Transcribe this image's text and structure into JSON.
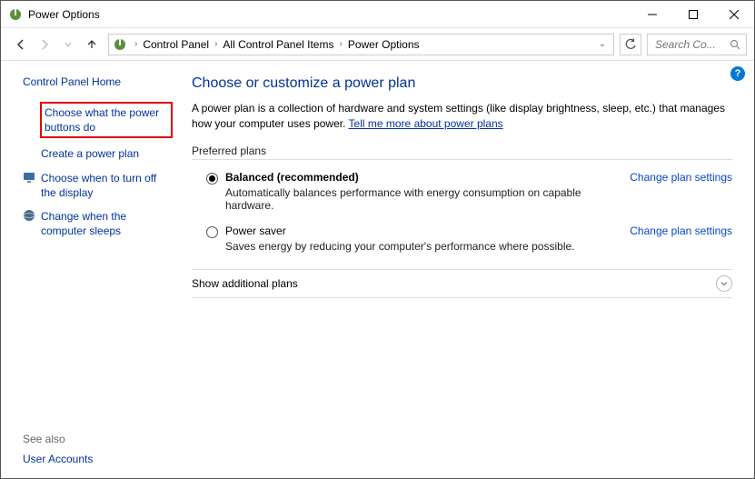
{
  "window": {
    "title": "Power Options"
  },
  "breadcrumb": {
    "items": [
      "Control Panel",
      "All Control Panel Items",
      "Power Options"
    ]
  },
  "search": {
    "placeholder": "Search Co..."
  },
  "sidebar": {
    "home": "Control Panel Home",
    "items": [
      {
        "label": "Choose what the power buttons do",
        "highlighted": true
      },
      {
        "label": "Create a power plan"
      },
      {
        "label": "Choose when to turn off the display",
        "icon": "display"
      },
      {
        "label": "Change when the computer sleeps",
        "icon": "globe"
      }
    ],
    "seealso_label": "See also",
    "seealso_items": [
      "User Accounts"
    ]
  },
  "main": {
    "heading": "Choose or customize a power plan",
    "description_pre": "A power plan is a collection of hardware and system settings (like display brightness, sleep, etc.) that manages how your computer uses power. ",
    "description_link": "Tell me more about power plans",
    "preferred_label": "Preferred plans",
    "plans": [
      {
        "name": "Balanced (recommended)",
        "desc": "Automatically balances performance with energy consumption on capable hardware.",
        "selected": true,
        "change": "Change plan settings"
      },
      {
        "name": "Power saver",
        "desc": "Saves energy by reducing your computer's performance where possible.",
        "selected": false,
        "change": "Change plan settings"
      }
    ],
    "show_additional": "Show additional plans"
  }
}
